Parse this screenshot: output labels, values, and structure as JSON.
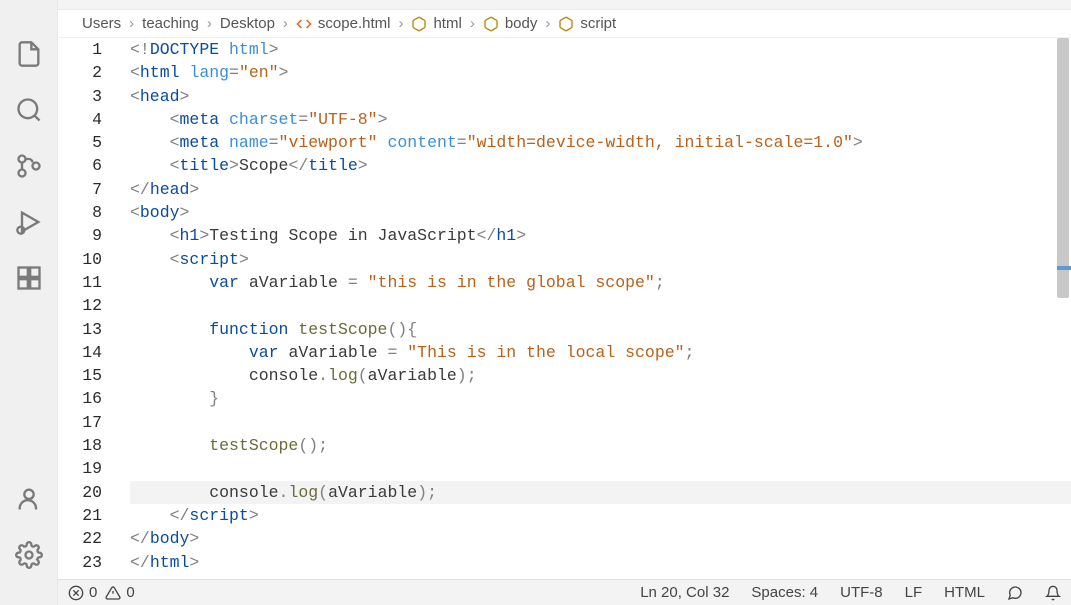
{
  "breadcrumb": {
    "items": [
      {
        "label": "Users",
        "icon": null
      },
      {
        "label": "teaching",
        "icon": null
      },
      {
        "label": "Desktop",
        "icon": null
      },
      {
        "label": "scope.html",
        "icon": "html-file"
      },
      {
        "label": "html",
        "icon": "cube"
      },
      {
        "label": "body",
        "icon": "cube"
      },
      {
        "label": "script",
        "icon": "cube"
      }
    ],
    "separator": "›"
  },
  "editor": {
    "file_name": "scope.html",
    "current_line": 20,
    "lines": [
      {
        "n": 1,
        "tokens": [
          [
            "pun",
            "<!"
          ],
          [
            "doctype",
            "DOCTYPE"
          ],
          [
            "txt",
            " "
          ],
          [
            "attr",
            "html"
          ],
          [
            "pun",
            ">"
          ]
        ]
      },
      {
        "n": 2,
        "tokens": [
          [
            "pun",
            "<"
          ],
          [
            "tag",
            "html"
          ],
          [
            "txt",
            " "
          ],
          [
            "attr",
            "lang"
          ],
          [
            "pun",
            "="
          ],
          [
            "str",
            "\"en\""
          ],
          [
            "pun",
            ">"
          ]
        ]
      },
      {
        "n": 3,
        "tokens": [
          [
            "pun",
            "<"
          ],
          [
            "tag",
            "head"
          ],
          [
            "pun",
            ">"
          ]
        ]
      },
      {
        "n": 4,
        "indent": 1,
        "tokens": [
          [
            "pun",
            "<"
          ],
          [
            "tag",
            "meta"
          ],
          [
            "txt",
            " "
          ],
          [
            "attr",
            "charset"
          ],
          [
            "pun",
            "="
          ],
          [
            "str",
            "\"UTF-8\""
          ],
          [
            "pun",
            ">"
          ]
        ]
      },
      {
        "n": 5,
        "indent": 1,
        "tokens": [
          [
            "pun",
            "<"
          ],
          [
            "tag",
            "meta"
          ],
          [
            "txt",
            " "
          ],
          [
            "attr",
            "name"
          ],
          [
            "pun",
            "="
          ],
          [
            "str",
            "\"viewport\""
          ],
          [
            "txt",
            " "
          ],
          [
            "attr",
            "content"
          ],
          [
            "pun",
            "="
          ],
          [
            "str",
            "\"width=device-width, initial-scale=1.0\""
          ],
          [
            "pun",
            ">"
          ]
        ]
      },
      {
        "n": 6,
        "indent": 1,
        "tokens": [
          [
            "pun",
            "<"
          ],
          [
            "tag",
            "title"
          ],
          [
            "pun",
            ">"
          ],
          [
            "txt",
            "Scope"
          ],
          [
            "pun",
            "</"
          ],
          [
            "tag",
            "title"
          ],
          [
            "pun",
            ">"
          ]
        ]
      },
      {
        "n": 7,
        "tokens": [
          [
            "pun",
            "</"
          ],
          [
            "tag",
            "head"
          ],
          [
            "pun",
            ">"
          ]
        ]
      },
      {
        "n": 8,
        "tokens": [
          [
            "pun",
            "<"
          ],
          [
            "tag",
            "body"
          ],
          [
            "pun",
            ">"
          ]
        ]
      },
      {
        "n": 9,
        "indent": 1,
        "tokens": [
          [
            "pun",
            "<"
          ],
          [
            "tag",
            "h1"
          ],
          [
            "pun",
            ">"
          ],
          [
            "txt",
            "Testing Scope in JavaScript"
          ],
          [
            "pun",
            "</"
          ],
          [
            "tag",
            "h1"
          ],
          [
            "pun",
            ">"
          ]
        ]
      },
      {
        "n": 10,
        "indent": 1,
        "tokens": [
          [
            "pun",
            "<"
          ],
          [
            "tag",
            "script"
          ],
          [
            "pun",
            ">"
          ]
        ]
      },
      {
        "n": 11,
        "indent": 2,
        "tokens": [
          [
            "kw",
            "var"
          ],
          [
            "txt",
            " aVariable "
          ],
          [
            "pun",
            "="
          ],
          [
            "txt",
            " "
          ],
          [
            "str",
            "\"this is in the global scope\""
          ],
          [
            "pun",
            ";"
          ]
        ]
      },
      {
        "n": 12,
        "tokens": []
      },
      {
        "n": 13,
        "indent": 2,
        "tokens": [
          [
            "kw",
            "function"
          ],
          [
            "txt",
            " "
          ],
          [
            "fn",
            "testScope"
          ],
          [
            "pun",
            "()"
          ],
          [
            "pun",
            "{"
          ]
        ]
      },
      {
        "n": 14,
        "indent": 3,
        "tokens": [
          [
            "kw",
            "var"
          ],
          [
            "txt",
            " aVariable "
          ],
          [
            "pun",
            "="
          ],
          [
            "txt",
            " "
          ],
          [
            "str",
            "\"This is in the local scope\""
          ],
          [
            "pun",
            ";"
          ]
        ]
      },
      {
        "n": 15,
        "indent": 3,
        "tokens": [
          [
            "txt",
            "console"
          ],
          [
            "pun",
            "."
          ],
          [
            "fn",
            "log"
          ],
          [
            "pun",
            "("
          ],
          [
            "txt",
            "aVariable"
          ],
          [
            "pun",
            ")"
          ],
          [
            "pun",
            ";"
          ]
        ]
      },
      {
        "n": 16,
        "indent": 2,
        "tokens": [
          [
            "pun",
            "}"
          ]
        ]
      },
      {
        "n": 17,
        "tokens": []
      },
      {
        "n": 18,
        "indent": 2,
        "tokens": [
          [
            "fn",
            "testScope"
          ],
          [
            "pun",
            "()"
          ],
          [
            "pun",
            ";"
          ]
        ]
      },
      {
        "n": 19,
        "tokens": []
      },
      {
        "n": 20,
        "indent": 2,
        "tokens": [
          [
            "txt",
            "console"
          ],
          [
            "pun",
            "."
          ],
          [
            "fn",
            "log"
          ],
          [
            "pun",
            "("
          ],
          [
            "txt",
            "aVariable"
          ],
          [
            "pun",
            ")"
          ],
          [
            "pun",
            ";"
          ]
        ]
      },
      {
        "n": 21,
        "indent": 1,
        "tokens": [
          [
            "pun",
            "</"
          ],
          [
            "tag",
            "script"
          ],
          [
            "pun",
            ">"
          ]
        ]
      },
      {
        "n": 22,
        "tokens": [
          [
            "pun",
            "</"
          ],
          [
            "tag",
            "body"
          ],
          [
            "pun",
            ">"
          ]
        ]
      },
      {
        "n": 23,
        "tokens": [
          [
            "pun",
            "</"
          ],
          [
            "tag",
            "html"
          ],
          [
            "pun",
            ">"
          ]
        ]
      }
    ]
  },
  "status": {
    "errors": "0",
    "warnings": "0",
    "cursor": "Ln 20, Col 32",
    "indent": "Spaces: 4",
    "encoding": "UTF-8",
    "eol": "LF",
    "language": "HTML"
  }
}
